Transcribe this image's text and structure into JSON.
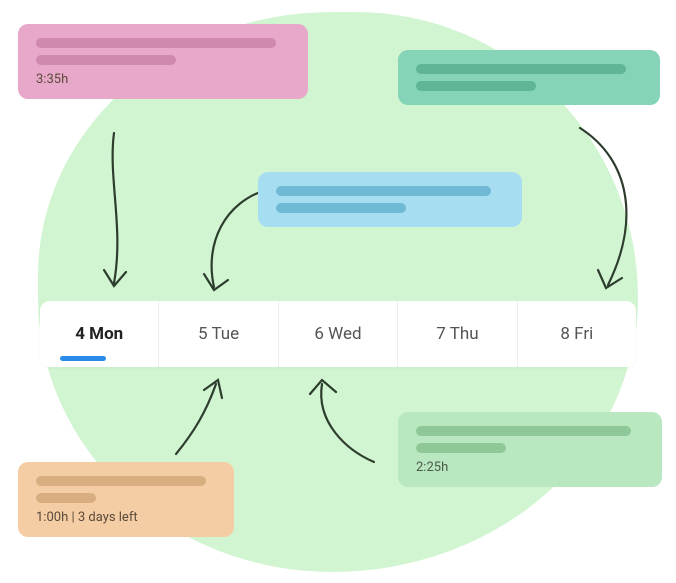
{
  "cards": {
    "pink": {
      "footer": "3:35h"
    },
    "orange": {
      "footer": "1:00h | 3 days left"
    },
    "green": {
      "footer": "2:25h"
    }
  },
  "week": {
    "days": [
      {
        "label": "4 Mon",
        "active": true
      },
      {
        "label": "5 Tue",
        "active": false
      },
      {
        "label": "6 Wed",
        "active": false
      },
      {
        "label": "7 Thu",
        "active": false
      },
      {
        "label": "8 Fri",
        "active": false
      }
    ]
  }
}
